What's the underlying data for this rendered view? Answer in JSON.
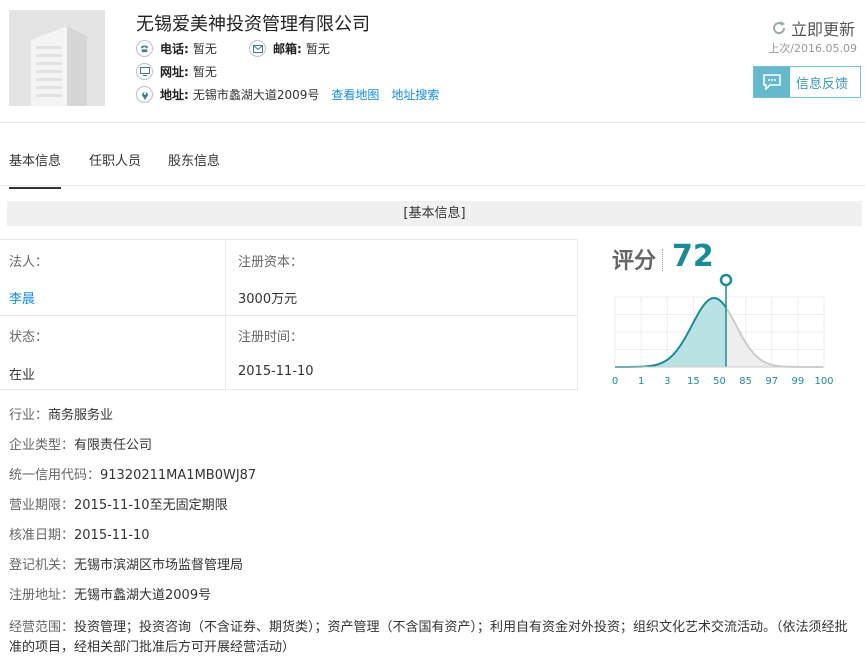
{
  "company": {
    "name": "无锡爱美神投资管理有限公司",
    "phone_label": "电话:",
    "phone_value": "暂无",
    "email_label": "邮箱:",
    "email_value": "暂无",
    "website_label": "网址:",
    "website_value": "暂无",
    "address_label": "地址:",
    "address_value": "无锡市蠡湖大道2009号",
    "view_map": "查看地图",
    "address_search": "地址搜索"
  },
  "actions": {
    "update_label": "立即更新",
    "last_update": "上次/2016.05.09",
    "feedback_label": "信息反馈"
  },
  "tabs": [
    "基本信息",
    "任职人员",
    "股东信息"
  ],
  "section_title": "[基本信息]",
  "grid": {
    "legal_person_key": "法人：",
    "legal_person_value": "李晨",
    "capital_key": "注册资本：",
    "capital_value": "3000万元",
    "status_key": "状态：",
    "status_value": "在业",
    "reg_time_key": "注册时间：",
    "reg_time_value": "2015-11-10"
  },
  "score": {
    "label": "评分",
    "value": "72",
    "axis_ticks": [
      "0",
      "1",
      "3",
      "15",
      "50",
      "85",
      "97",
      "99",
      "100"
    ],
    "accent": "#1a8c98"
  },
  "details": [
    {
      "key": "行业：",
      "value": "商务服务业"
    },
    {
      "key": "企业类型：",
      "value": "有限责任公司"
    },
    {
      "key": "统一信用代码：",
      "value": "91320211MA1MB0WJ87"
    },
    {
      "key": "营业期限：",
      "value": "2015-11-10至无固定期限"
    },
    {
      "key": "核准日期：",
      "value": "2015-11-10"
    },
    {
      "key": "登记机关：",
      "value": "无锡市滨湖区市场监督管理局"
    },
    {
      "key": "注册地址：",
      "value": "无锡市蠡湖大道2009号"
    }
  ],
  "scope": {
    "key": "经营范围：",
    "value": "投资管理；投资咨询（不含证券、期货类）；资产管理（不含国有资产）；利用自有资金对外投资；组织文化艺术交流活动。（依法须经批准的项目，经相关部门批准后方可开展经营活动）"
  }
}
